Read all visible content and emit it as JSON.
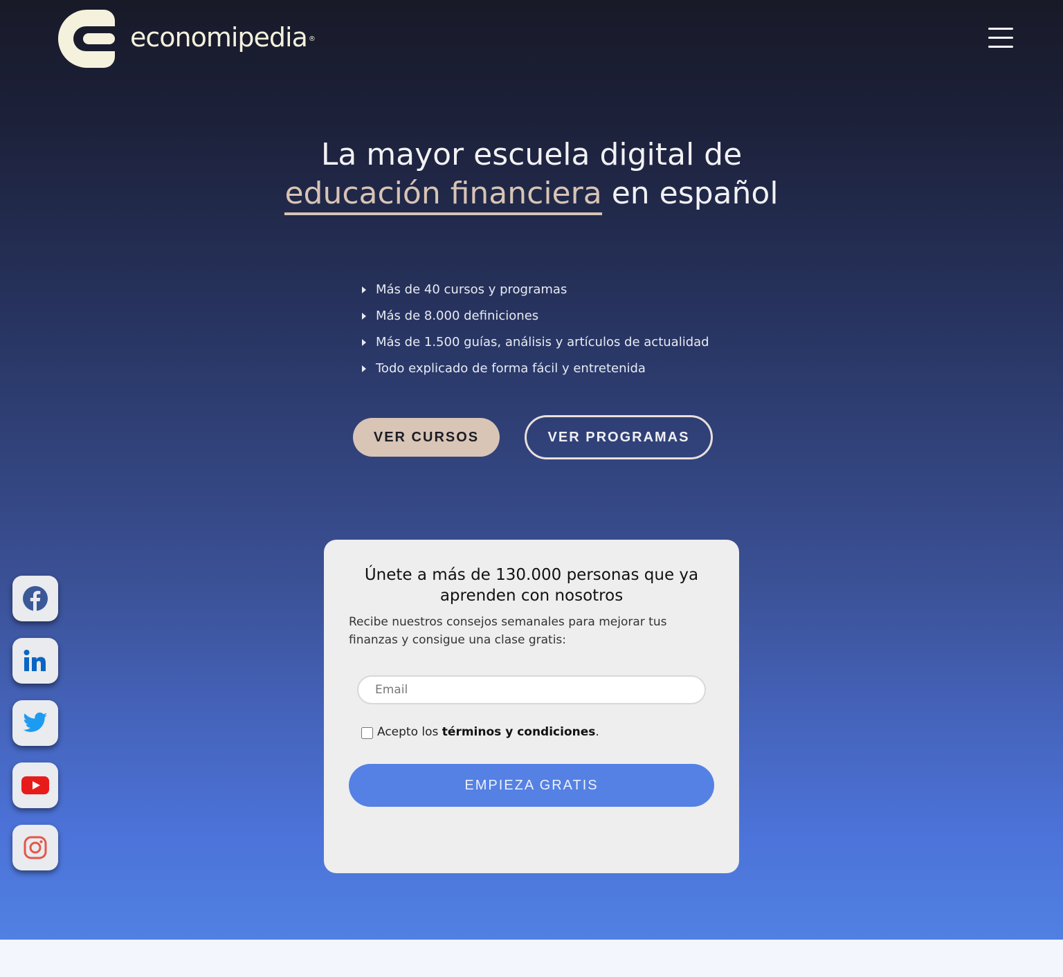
{
  "header": {
    "logo_text": "economipedia",
    "logo_reg": "®"
  },
  "hero": {
    "headline_line1": "La mayor escuela digital de",
    "headline_accent": "educación financiera",
    "headline_tail": "en español",
    "features": [
      "Más de 40 cursos y programas",
      "Más de 8.000 definiciones",
      "Más de 1.500 guías, análisis y artículos de actualidad",
      "Todo explicado de forma fácil y entretenida"
    ],
    "btn_courses": "VER CURSOS",
    "btn_programs": "VER PROGRAMAS"
  },
  "signup": {
    "title": "Únete a más de 130.000 personas que ya aprenden con nosotros",
    "subtitle": "Recibe nuestros consejos semanales para mejorar tus finanzas y consigue una clase gratis:",
    "email_placeholder": "Email",
    "terms_prefix": "Acepto los",
    "terms_link": "términos y condiciones",
    "terms_suffix": ".",
    "submit": "EMPIEZA GRATIS"
  },
  "social": [
    "facebook-icon",
    "linkedin-icon",
    "twitter-icon",
    "youtube-icon",
    "instagram-icon"
  ],
  "colors": {
    "accent_beige": "#d9c5b6",
    "cta_blue": "#5481e3",
    "logo_cream": "#f4f1dd"
  }
}
